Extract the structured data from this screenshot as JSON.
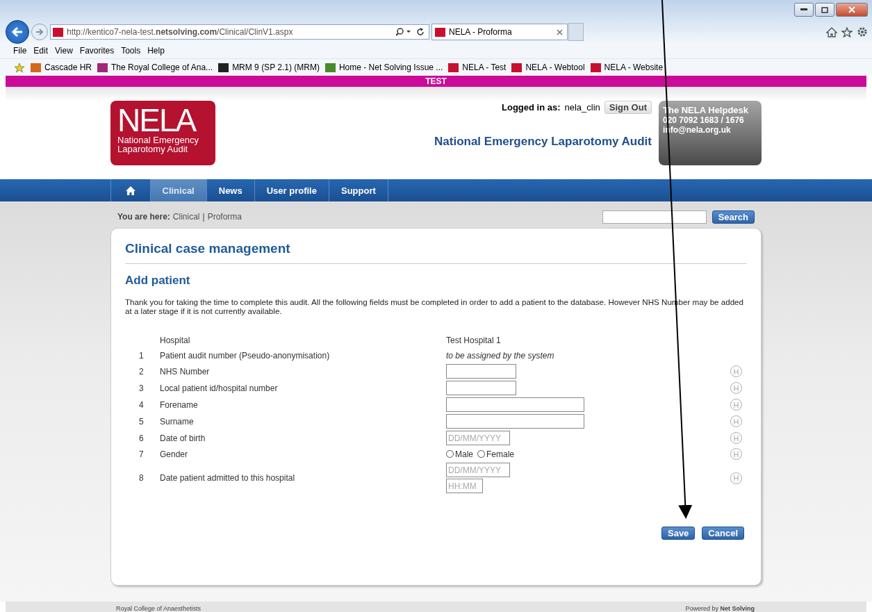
{
  "browser": {
    "url": "http://kentico7-nela-test.**netsolving.com**/Clinical/ClinV1.aspx",
    "tab": "NELA - Proforma",
    "menu": [
      "File",
      "Edit",
      "View",
      "Favorites",
      "Tools",
      "Help"
    ],
    "favorites": [
      {
        "label": "Cascade HR"
      },
      {
        "label": "The Royal College of Ana..."
      },
      {
        "label": "MRM 9 (SP 2.1) (MRM)"
      },
      {
        "label": "Home - Net Solving Issue ..."
      },
      {
        "label": "NELA - Test"
      },
      {
        "label": "NELA - Webtool"
      },
      {
        "label": "NELA - Website"
      }
    ]
  },
  "banner": "TEST",
  "header": {
    "logo": {
      "mark": "NELA",
      "lines": [
        "National Emergency",
        "Laparotomy Audit"
      ]
    },
    "logged_in_label": "Logged in as:",
    "user": "nela_clin",
    "sign_out": "Sign Out",
    "site_title": "National Emergency Laparotomy Audit",
    "helpdesk": [
      "The NELA Helpdesk",
      "020 7092 1683 / 1676",
      "info@nela.org.uk"
    ]
  },
  "nav": [
    {
      "kind": "home",
      "selected": false
    },
    {
      "label": "Clinical",
      "selected": true
    },
    {
      "label": "News",
      "selected": false
    },
    {
      "label": "User profile",
      "selected": false
    },
    {
      "label": "Support",
      "selected": false
    }
  ],
  "breadcrumb": {
    "label": "You are here:",
    "separator": "|",
    "path": [
      "Clinical",
      "Proforma"
    ]
  },
  "search": {
    "button": "Search"
  },
  "card": {
    "title": "Clinical case management",
    "subtitle": "Add patient",
    "intro": "Thank you for taking the time to complete this audit. All the following fields must be completed in order to add a patient to the database. However NHS Number may be added at a later stage if it is not currently available.",
    "rows": [
      {
        "label": "Hospital",
        "kind": "text",
        "value": "Test Hospital 1"
      },
      {
        "number": "1",
        "label": "Patient audit number (Pseudo-anonymisation)",
        "kind": "note",
        "value": "to be assigned by the system"
      },
      {
        "number": "2",
        "label": "NHS Number",
        "kind": "short-input",
        "help": "H"
      },
      {
        "number": "3",
        "label": "Local patient id/hospital number",
        "kind": "short-input",
        "help": "H"
      },
      {
        "number": "4",
        "label": "Forename",
        "kind": "long-input",
        "help": "H"
      },
      {
        "number": "5",
        "label": "Surname",
        "kind": "long-input",
        "help": "H"
      },
      {
        "number": "6",
        "label": "Date of birth",
        "kind": "date",
        "placeholder": "DD/MM/YYYY",
        "help": "H"
      },
      {
        "number": "7",
        "label": "Gender",
        "kind": "radio",
        "options": [
          {
            "label": "Male",
            "selected": false
          },
          {
            "label": "Female",
            "selected": false
          }
        ],
        "help": "H"
      },
      {
        "number": "8",
        "label": "Date patient admitted to this hospital",
        "kind": "datetime",
        "placeholder": "DD/MM/YYYY",
        "time_placeholder": "HH:MM",
        "help": "H"
      }
    ],
    "buttons": [
      {
        "label": "Save"
      },
      {
        "label": "Cancel"
      }
    ]
  },
  "footer": {
    "left": "Royal College of Anaesthetists",
    "right": "Powered by **Net Solving**"
  }
}
